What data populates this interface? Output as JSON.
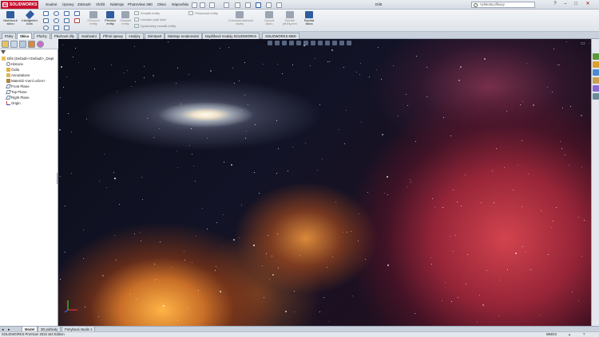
{
  "app": {
    "logo": "SOLIDWORKS",
    "document_title": "Díl6"
  },
  "menu": [
    "Soubor",
    "Úpravy",
    "Zobrazit",
    "Vložit",
    "Nástroje",
    "PhotoView 360",
    "Okno",
    "Nápověda"
  ],
  "search": {
    "placeholder": "Vyhledat příkazy"
  },
  "window_controls": [
    "?",
    "–",
    "□",
    "✕"
  ],
  "ribbon": {
    "sketch_button": "Načrtnout skicu",
    "smart_dim_button": "Inteligentní kóta",
    "trim_button": "Oříznout entity",
    "convert_button": "Převést entity",
    "offset_button": "Odsadit entity",
    "mirror_label": "Zrcadlit entity",
    "linear_pattern_label": "Lineární pole skici",
    "dynamic_mirror_label": "Dynamicky zrcadlit entity",
    "move_label": "Přesunout entity",
    "display_relations_button": "Zobrazit/odstranit vazby",
    "repair_button": "Opravit skicu",
    "quick_snaps_button": "Rychlé přichycení",
    "rapid_sketch_button": "Rychlá skica"
  },
  "command_tabs": [
    "Prvky",
    "Skica",
    "Plochy",
    "Plechové díly",
    "Svařování",
    "Přímé úpravy",
    "Analýzy",
    "DimXpert",
    "Nástroje renderování",
    "Doplňkové moduly SOLIDWORKS",
    "SOLIDWORKS MBD"
  ],
  "active_command_tab": "Skica",
  "feature_tree": {
    "root": "Díl6  (Default<<Default>_Displ",
    "items": [
      "Historie",
      "Čidla",
      "Annotations",
      "Materiál <není určen>",
      "Front Plane",
      "Top Plane",
      "Right Plane",
      "Origin"
    ]
  },
  "bottom_tabs": [
    "Model",
    "3D pohledy",
    "Pohybová studie 1"
  ],
  "status": {
    "left": "SOLIDWORKS Premium 2015 x64 Edition",
    "units": "MMGS"
  },
  "colors": {
    "accent": "#c8102e",
    "ribbon_icon_blue": "#2f5d9e"
  }
}
